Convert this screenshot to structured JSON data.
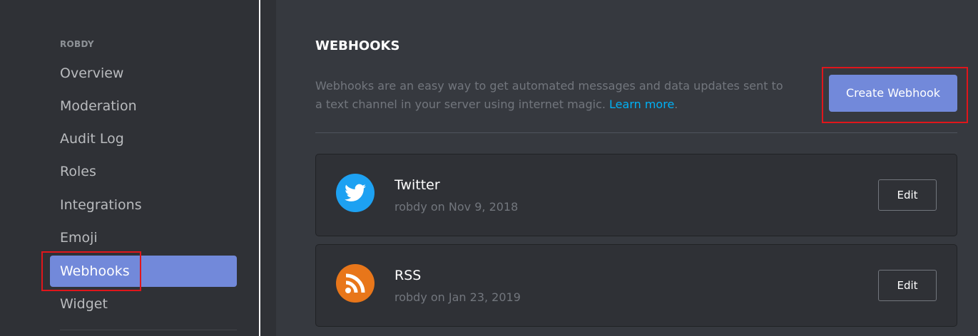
{
  "sidebar": {
    "section": "ROBDY",
    "items": [
      {
        "label": "Overview"
      },
      {
        "label": "Moderation"
      },
      {
        "label": "Audit Log"
      },
      {
        "label": "Roles"
      },
      {
        "label": "Integrations"
      },
      {
        "label": "Emoji"
      },
      {
        "label": "Webhooks"
      },
      {
        "label": "Widget"
      }
    ]
  },
  "main": {
    "title": "WEBHOOKS",
    "description": "Webhooks are an easy way to get automated messages and data updates sent to a text channel in your server using internet magic. ",
    "learn_more": "Learn more",
    "period": ".",
    "create_button": "Create Webhook",
    "webhooks": [
      {
        "name": "Twitter",
        "meta": "robdy on Nov 9, 2018",
        "icon": "twitter-icon",
        "color": "#1da1f2",
        "edit": "Edit"
      },
      {
        "name": "RSS",
        "meta": "robdy on Jan 23, 2019",
        "icon": "rss-icon",
        "color": "#e8761a",
        "edit": "Edit"
      }
    ]
  },
  "colors": {
    "accent": "#7289da",
    "highlight": "#e0161b"
  }
}
